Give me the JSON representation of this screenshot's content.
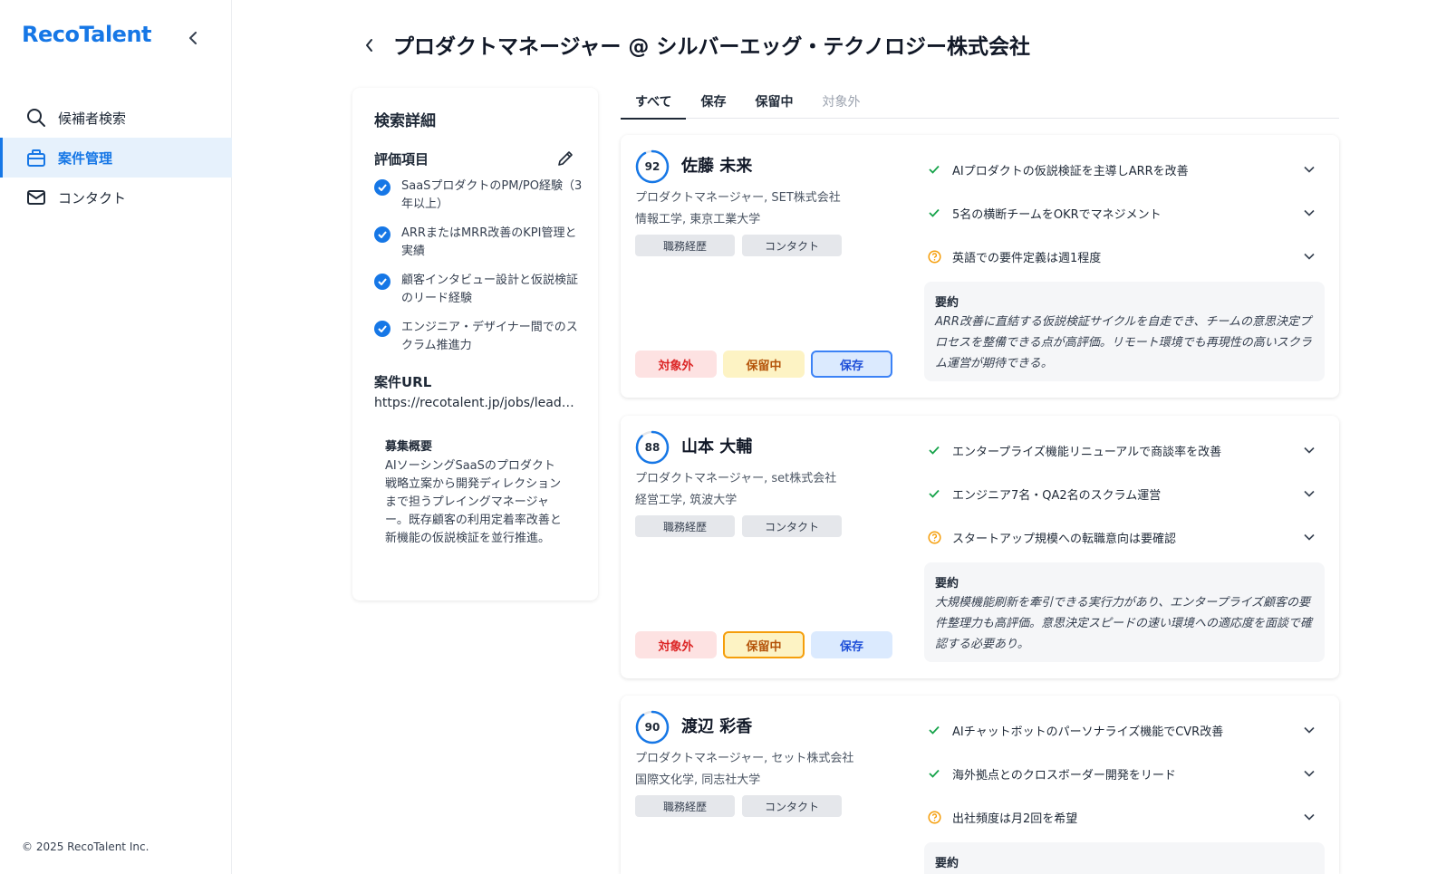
{
  "app": {
    "logo": "RecoTalent",
    "copyright": "© 2025 RecoTalent Inc."
  },
  "sidebar": {
    "items": [
      {
        "label": "候補者検索",
        "icon": "search-icon",
        "active": false
      },
      {
        "label": "案件管理",
        "icon": "briefcase-icon",
        "active": true
      },
      {
        "label": "コンタクト",
        "icon": "mail-icon",
        "active": false
      }
    ]
  },
  "header": {
    "title": "プロダクトマネージャー @ シルバーエッグ・テクノロジー株式会社"
  },
  "detail": {
    "title": "検索詳細",
    "criteria_heading": "評価項目",
    "criteria": [
      "SaaSプロダクトのPM/PO経験（3年以上）",
      "ARRまたはMRR改善のKPI管理と実績",
      "顧客インタビュー設計と仮説検証のリード経験",
      "エンジニア・デザイナー間でのスクラム推進力"
    ],
    "url_heading": "案件URL",
    "url": "https://recotalent.jp/jobs/lead-pm-silveregg",
    "summary_heading": "募集概要",
    "summary": "AIソーシングSaaSのプロダクト戦略立案から開発ディレクションまで担うプレイングマネージャー。既存顧客の利用定着率改善と新機能の仮説検証を並行推進。"
  },
  "tabs": [
    {
      "label": "すべて",
      "state": "active"
    },
    {
      "label": "保存",
      "state": "normal"
    },
    {
      "label": "保留中",
      "state": "normal"
    },
    {
      "label": "対象外",
      "state": "muted"
    }
  ],
  "labels": {
    "chip_career": "職務経歴",
    "chip_contact": "コンタクト",
    "btn_exclude": "対象外",
    "btn_hold": "保留中",
    "btn_save": "保存",
    "summary": "要約"
  },
  "colors": {
    "accent": "#1677e6",
    "check": "#16a34a",
    "warn": "#f59e0b"
  },
  "candidates": [
    {
      "score": "92",
      "score_pct": 92,
      "name": "佐藤 未来",
      "role": "プロダクトマネージャー, SET株式会社",
      "education": "情報工学, 東京工業大学",
      "status": "save",
      "points": [
        {
          "text": "AIプロダクトの仮説検証を主導しARRを改善",
          "type": "check"
        },
        {
          "text": "5名の横断チームをOKRでマネジメント",
          "type": "check"
        },
        {
          "text": "英語での要件定義は週1程度",
          "type": "warn"
        }
      ],
      "summary": "ARR改善に直結する仮説検証サイクルを自走でき、チームの意思決定プロセスを整備できる点が高評価。リモート環境でも再現性の高いスクラム運営が期待できる。"
    },
    {
      "score": "88",
      "score_pct": 88,
      "name": "山本 大輔",
      "role": "プロダクトマネージャー, set株式会社",
      "education": "経営工学, 筑波大学",
      "status": "hold",
      "points": [
        {
          "text": "エンタープライズ機能リニューアルで商談率を改善",
          "type": "check"
        },
        {
          "text": "エンジニア7名・QA2名のスクラム運営",
          "type": "check"
        },
        {
          "text": "スタートアップ規模への転職意向は要確認",
          "type": "warn"
        }
      ],
      "summary": "大規模機能刷新を牽引できる実行力があり、エンタープライズ顧客の要件整理力も高評価。意思決定スピードの速い環境への適応度を面談で確認する必要あり。"
    },
    {
      "score": "90",
      "score_pct": 90,
      "name": "渡辺 彩香",
      "role": "プロダクトマネージャー, セット株式会社",
      "education": "国際文化学, 同志社大学",
      "status": "none",
      "points": [
        {
          "text": "AIチャットボットのパーソナライズ機能でCVR改善",
          "type": "check"
        },
        {
          "text": "海外拠点とのクロスボーダー開発をリード",
          "type": "check"
        },
        {
          "text": "出社頻度は月2回を希望",
          "type": "warn"
        }
      ],
      "summary": ""
    }
  ]
}
